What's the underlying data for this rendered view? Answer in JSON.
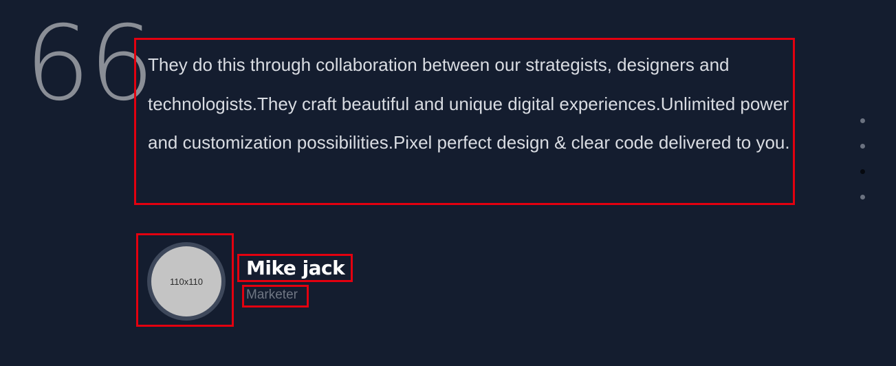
{
  "testimonial": {
    "quote_glyph": "66",
    "text": "They do this through collaboration between our strategists, designers and technologists.They craft beautiful and unique digital experiences.Unlimited power and customization possibilities.Pixel perfect design & clear code delivered to you.",
    "avatar_placeholder": "110x110",
    "author_name": "Mike jack",
    "author_role": "Marketer"
  },
  "pagination": {
    "total": 4,
    "active_index": 2
  },
  "colors": {
    "background": "#141d2f",
    "highlight": "#e3000f",
    "text": "#d9dce2",
    "muted": "#6f7683"
  }
}
